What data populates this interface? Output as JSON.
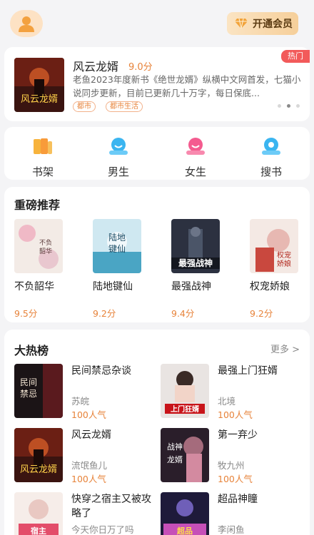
{
  "topbar": {
    "vip_label": "开通会员"
  },
  "banner": {
    "title": "风云龙婿",
    "score": "9.0分",
    "badge": "热门",
    "description": "老鱼2023年度新书《绝世龙婿》纵横中文网首发，七猫小说同步更新，目前已更新几十万字，每日保底...",
    "tags": [
      "都市",
      "都市生活"
    ]
  },
  "quick_nav": [
    {
      "label": "书架",
      "icon": "bookshelf-icon"
    },
    {
      "label": "男生",
      "icon": "male-icon"
    },
    {
      "label": "女生",
      "icon": "female-icon"
    },
    {
      "label": "搜书",
      "icon": "search-icon"
    }
  ],
  "recommend": {
    "title": "重磅推荐",
    "books": [
      {
        "name": "不负韶华",
        "score": "9.5分"
      },
      {
        "name": "陆地键仙",
        "score": "9.2分"
      },
      {
        "name": "最强战神",
        "score": "9.4分"
      },
      {
        "name": "权宠娇娘",
        "score": "9.2分"
      }
    ]
  },
  "hotlist": {
    "title": "大热榜",
    "more_label": "更多 >",
    "items": [
      {
        "title": "民间禁忌杂谈",
        "author": "苏皖",
        "popularity": "100人气"
      },
      {
        "title": "最强上门狂婿",
        "author": "北境",
        "popularity": "100人气"
      },
      {
        "title": "风云龙婿",
        "author": "流氓鱼儿",
        "popularity": "100人气"
      },
      {
        "title": "第一弃少",
        "author": "牧九州",
        "popularity": "100人气"
      },
      {
        "title": "快穿之宿主又被攻略了",
        "author": "今天你日万了吗",
        "popularity": ""
      },
      {
        "title": "超品神瞳",
        "author": "李闲鱼",
        "popularity": ""
      }
    ]
  },
  "colors": {
    "accent": "#e7833a",
    "hot": "#f25a5a",
    "vip_text": "#5a3a12"
  }
}
